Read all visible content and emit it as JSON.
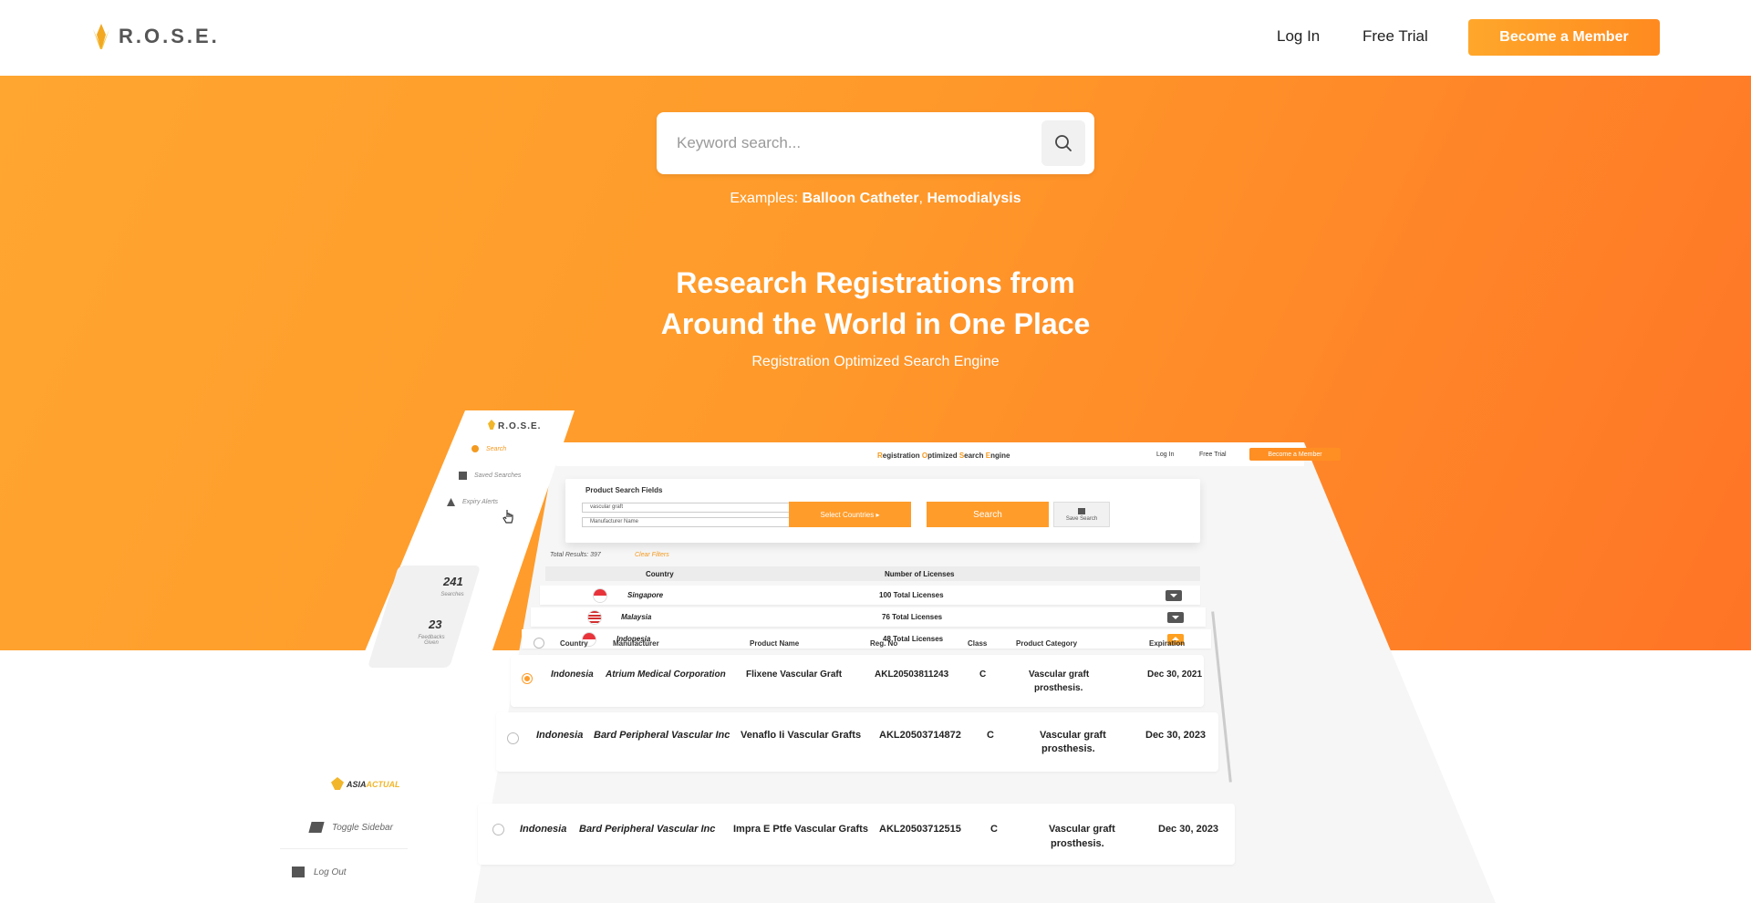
{
  "header": {
    "logo_text": "R.O.S.E.",
    "nav": {
      "login": "Log In",
      "free_trial": "Free Trial",
      "member": "Become a Member"
    },
    "accent_color": "#ff9a2a"
  },
  "hero": {
    "search_placeholder": "Keyword search...",
    "examples_prefix": "Examples:",
    "example_1": "Balloon Catheter",
    "example_sep": ",",
    "example_2": "Hemodialysis",
    "title_line1": "Research Registrations from",
    "title_line2": "Around the World in One Place",
    "subtitle": "Registration Optimized Search Engine",
    "gradient": [
      "#ffa630",
      "#ff7426"
    ]
  },
  "mockup": {
    "sidebar": {
      "logo": "R.O.S.E.",
      "items": [
        {
          "label": "Search",
          "icon": "search-icon",
          "active": true
        },
        {
          "label": "Saved Searches",
          "icon": "bookmark-icon",
          "active": false
        },
        {
          "label": "Expiry Alerts",
          "icon": "alert-icon",
          "active": false
        }
      ],
      "stats": [
        {
          "value": "241",
          "label": "Searches"
        },
        {
          "value": "23",
          "label": "Feedbacks Given"
        }
      ],
      "brand_a": "ASIA",
      "brand_b": "ACTUAL",
      "toggle_sidebar": "Toggle Sidebar",
      "logout": "Log Out"
    },
    "topbar": {
      "title": [
        {
          "h": "R",
          "t": "egistration "
        },
        {
          "h": "O",
          "t": "ptimized "
        },
        {
          "h": "S",
          "t": "earch "
        },
        {
          "h": "E",
          "t": "ngine"
        }
      ],
      "login": "Log In",
      "free_trial": "Free Trial",
      "member": "Become a Member"
    },
    "search_fields": {
      "title": "Product Search Fields",
      "product_value": "vascular graft",
      "manufacturer_placeholder": "Manufacturer Name",
      "select_countries": "Select Countries ▸",
      "search_button": "Search",
      "save_search": "Save Search"
    },
    "total_results": "Total Results: 397",
    "clear_filters": "Clear Filters",
    "country_table": {
      "headers": [
        "Country",
        "Number of Licenses"
      ],
      "rows": [
        {
          "country": "Singapore",
          "licenses": "100 Total Licenses",
          "expanded": false
        },
        {
          "country": "Malaysia",
          "licenses": "76 Total Licenses",
          "expanded": false
        },
        {
          "country": "Indonesia",
          "licenses": "48 Total Licenses",
          "expanded": true
        }
      ]
    },
    "results_table": {
      "headers": [
        "Country",
        "Manufacturer",
        "Product Name",
        "Reg. No",
        "Class",
        "Product Category",
        "Expiration"
      ],
      "rows": [
        {
          "country": "Indonesia",
          "manufacturer": "Atrium Medical Corporation",
          "product": "Flixene Vascular Graft",
          "reg_no": "AKL20503811243",
          "class": "C",
          "category_1": "Vascular graft",
          "category_2": "prosthesis.",
          "expiration": "Dec 30, 2021",
          "selected": true
        },
        {
          "country": "Indonesia",
          "manufacturer": "Bard Peripheral Vascular Inc",
          "product": "Venaflo Ii Vascular Grafts",
          "reg_no": "AKL20503714872",
          "class": "C",
          "category_1": "Vascular graft",
          "category_2": "prosthesis.",
          "expiration": "Dec 30, 2023",
          "selected": false
        },
        {
          "country": "Indonesia",
          "manufacturer": "Bard Peripheral Vascular Inc",
          "product": "Impra E Ptfe Vascular Grafts",
          "reg_no": "AKL20503712515",
          "class": "C",
          "category_1": "Vascular graft",
          "category_2": "prosthesis.",
          "expiration": "Dec 30, 2023",
          "selected": false
        }
      ]
    }
  }
}
